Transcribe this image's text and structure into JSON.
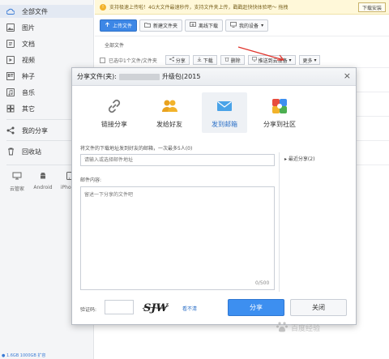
{
  "sidebar": {
    "items": [
      {
        "label": "全部文件",
        "icon": "cloud-icon"
      },
      {
        "label": "图片",
        "icon": "image-icon"
      },
      {
        "label": "文档",
        "icon": "document-icon"
      },
      {
        "label": "视频",
        "icon": "video-icon"
      },
      {
        "label": "种子",
        "icon": "bt-icon",
        "glyph": "BT"
      },
      {
        "label": "音乐",
        "icon": "music-icon"
      },
      {
        "label": "其它",
        "icon": "other-icon"
      }
    ],
    "share_label": "我的分享",
    "recycle_label": "回收站",
    "devices": [
      {
        "label": "云管家",
        "icon": "monitor-icon"
      },
      {
        "label": "Android",
        "icon": "android-icon"
      },
      {
        "label": "iPhone",
        "icon": "iphone-icon"
      }
    ],
    "bottom_text": "● 1.6GB 1000GB 扩容"
  },
  "notice": {
    "text": "支持极速上传啦！4G大文件最速秒传，支持文件夹上传，戳戳赶快快体验吧～ 拖拽",
    "download_label": "下载安装"
  },
  "toolbar": {
    "upload": "上传文件",
    "new_folder": "新建文件夹",
    "offline": "离线下载",
    "device": "我的设备"
  },
  "breadcrumb": "全部文件",
  "background_row": {
    "selected_text": "已选中1个文件/文件夹",
    "share": "分享",
    "download": "下载",
    "delete": "删除",
    "push": "推送到云设备",
    "more": "更多"
  },
  "dialog": {
    "title_prefix": "分享文件(夹):",
    "title_suffix": "升级包(2015",
    "close": "×",
    "options": [
      {
        "label": "链接分享",
        "icon": "link-icon"
      },
      {
        "label": "发给好友",
        "icon": "friends-icon"
      },
      {
        "label": "发到邮箱",
        "icon": "email-icon"
      },
      {
        "label": "分享到社区",
        "icon": "community-icon"
      }
    ],
    "address_label": "将文件的下载地址发到好友的邮箱，一次最多5人(0)",
    "address_placeholder": "请输入或选择邮件地址",
    "recent_label": "▸ 最近分享(2)",
    "content_label": "邮件内容:",
    "content_placeholder": "留述一下分享的文件吧",
    "counter": "0/500",
    "captcha_label": "验证码:",
    "captcha_text": "SJW",
    "captcha_refresh": "看不清",
    "share_button": "分享",
    "close_button": "关闭"
  },
  "watermark": "百度经验"
}
